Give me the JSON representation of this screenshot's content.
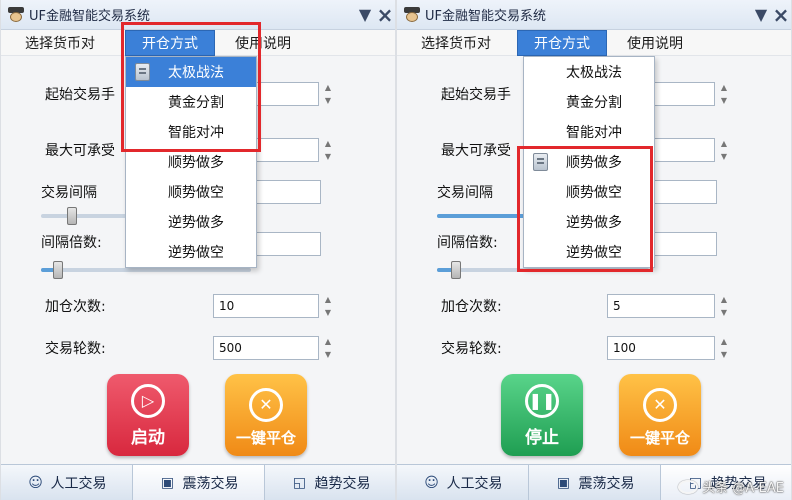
{
  "left": {
    "title": "UF金融智能交易系统",
    "window_controls": {
      "minimize": "▼",
      "close": "×"
    },
    "menu": [
      "选择货币对",
      "开仓方式",
      "使用说明"
    ],
    "labels": {
      "start_lot": "起始交易手",
      "max_loss": "最大可承受",
      "interval": "交易间隔",
      "interval_mult": "间隔倍数:",
      "add_count": "加仓次数:",
      "rounds": "交易轮数:"
    },
    "fields": {
      "start_lot": "",
      "max_loss": "",
      "interval": "",
      "interval_mult": "",
      "add_count": "10",
      "rounds": "500"
    },
    "sliders": {
      "interval": 0.2,
      "interval_mult": 0.1
    },
    "dropdown": [
      "太极战法",
      "黄金分割",
      "智能对冲",
      "顺势做多",
      "顺势做空",
      "逆势做多",
      "逆势做空"
    ],
    "dropdown_selected": 0,
    "buttons": {
      "start": "启动",
      "close_all": "一键平仓"
    },
    "tabs": [
      "人工交易",
      "震荡交易",
      "趋势交易"
    ]
  },
  "right": {
    "title": "UF金融智能交易系统",
    "window_controls": {
      "minimize": "▼",
      "close": "×"
    },
    "menu": [
      "选择货币对",
      "开仓方式",
      "使用说明"
    ],
    "labels": {
      "start_lot": "起始交易手",
      "max_loss": "最大可承受",
      "interval": "交易间隔",
      "interval_mult": "间隔倍数:",
      "add_count": "加仓次数:",
      "rounds": "交易轮数:"
    },
    "fields": {
      "start_lot": "",
      "max_loss": "",
      "interval": "",
      "interval_mult": "",
      "add_count": "5",
      "rounds": "100"
    },
    "sliders": {
      "interval": 1.0,
      "interval_mult": 0.1
    },
    "dropdown": [
      "太极战法",
      "黄金分割",
      "智能对冲",
      "顺势做多",
      "顺势做空",
      "逆势做多",
      "逆势做空"
    ],
    "dropdown_selected": 3,
    "buttons": {
      "stop": "停止",
      "close_all": "一键平仓"
    },
    "tabs": [
      "人工交易",
      "震荡交易",
      "趋势交易"
    ]
  },
  "watermark": "头条 @A-EAE",
  "colors": {
    "highlight": "#3b80d8",
    "annotation_red": "#e2282c",
    "start_red": "#d8283e",
    "close_orange": "#f08a16",
    "stop_green": "#1f9e52"
  }
}
